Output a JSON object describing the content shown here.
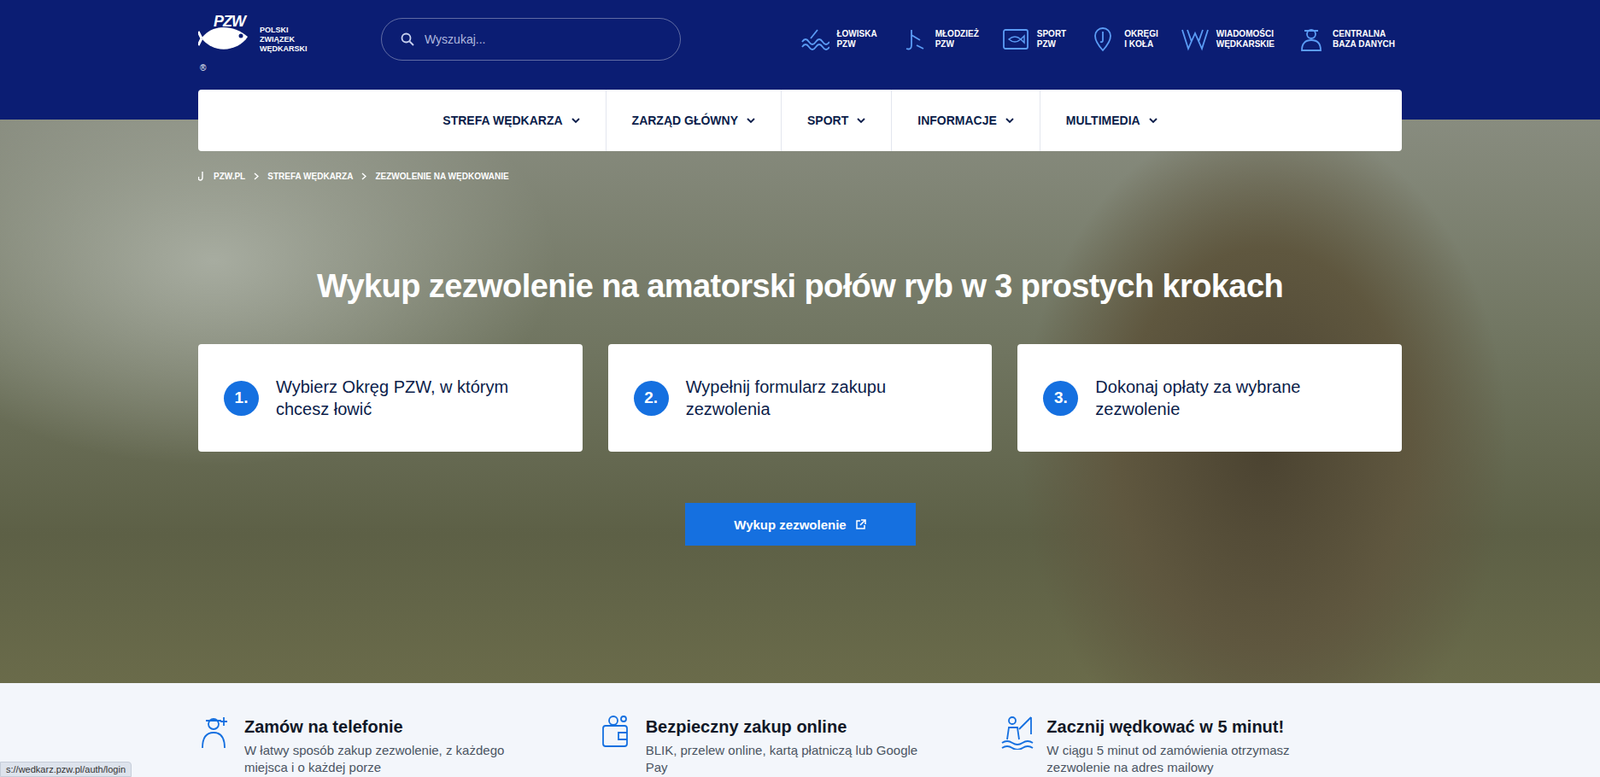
{
  "logo": {
    "mark": "PZW",
    "lines": [
      "POLSKI",
      "ZWIĄZEK",
      "WĘDKARSKI"
    ],
    "registered": "®"
  },
  "search": {
    "placeholder": "Wyszukaj..."
  },
  "quick_links": [
    {
      "lines": [
        "ŁOWISKA",
        "PZW"
      ]
    },
    {
      "lines": [
        "MŁODZIEŻ",
        "PZW"
      ]
    },
    {
      "lines": [
        "SPORT",
        "PZW"
      ]
    },
    {
      "lines": [
        "OKRĘGI",
        "I KOŁA"
      ]
    },
    {
      "lines": [
        "WIADOMOŚCI",
        "WĘDKARSKIE"
      ]
    },
    {
      "lines": [
        "CENTRALNA",
        "BAZA DANYCH"
      ]
    }
  ],
  "nav": [
    {
      "label": "STREFA WĘDKARZA",
      "expandable": true
    },
    {
      "label": "ZARZĄD GŁÓWNY",
      "expandable": true
    },
    {
      "label": "SPORT",
      "expandable": true
    },
    {
      "label": "INFORMACJE",
      "expandable": true
    },
    {
      "label": "MULTIMEDIA",
      "expandable": true
    }
  ],
  "breadcrumb": [
    "PZW.PL",
    "STREFA WĘDKARZA",
    "ZEZWOLENIE NA WĘDKOWANIE"
  ],
  "hero": {
    "title": "Wykup zezwolenie na amatorski połów ryb w 3 prostych krokach",
    "steps": [
      {
        "number": "1.",
        "text": "Wybierz Okręg PZW, w którym chcesz łowić"
      },
      {
        "number": "2.",
        "text": "Wypełnij formularz zakupu zezwolenia"
      },
      {
        "number": "3.",
        "text": "Dokonaj opłaty za wybrane zezwolenie"
      }
    ],
    "button": "Wykup zezwolenie"
  },
  "features": [
    {
      "title": "Zamów na telefonie",
      "description": "W łatwy sposób zakup zezwolenie, z każdego miejsca i o każdej porze"
    },
    {
      "title": "Bezpieczny zakup online",
      "description": "BLIK, przelew online, kartą płatniczą lub Google Pay"
    },
    {
      "title": "Zacznij wędkować w 5 minut!",
      "description": "W ciągu 5 minut od zamówienia otrzymasz zezwolenie na adres mailowy"
    }
  ],
  "status_url": "s://wedkarz.pzw.pl/auth/login"
}
